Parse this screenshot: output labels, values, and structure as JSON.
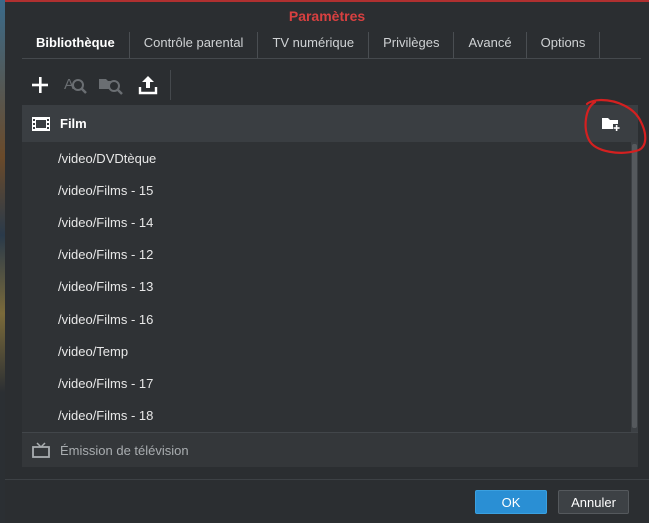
{
  "dialog": {
    "title": "Paramètres"
  },
  "tabs": [
    {
      "label": "Bibliothèque",
      "active": true
    },
    {
      "label": "Contrôle parental",
      "active": false
    },
    {
      "label": "TV numérique",
      "active": false
    },
    {
      "label": "Privilèges",
      "active": false
    },
    {
      "label": "Avancé",
      "active": false
    },
    {
      "label": "Options",
      "active": false
    }
  ],
  "toolbar": {
    "icons": [
      "add-icon",
      "search-text-icon",
      "search-folder-icon",
      "upload-icon"
    ]
  },
  "library": {
    "group_title": "Film",
    "group_icon": "film-icon",
    "add_folder_icon": "folder-add-icon",
    "folders": [
      "/video/DVDtèque",
      "/video/Films - 15",
      "/video/Films - 14",
      "/video/Films - 12",
      "/video/Films - 13",
      "/video/Films - 16",
      "/video/Temp",
      "/video/Films - 17",
      "/video/Films - 18"
    ],
    "second_group_title": "Émission de télévision",
    "second_group_icon": "tv-icon"
  },
  "buttons": {
    "ok": "OK",
    "cancel": "Annuler"
  },
  "colors": {
    "title": "#d84040",
    "ok_button": "#2a8fd4",
    "annotation": "#d42020"
  }
}
